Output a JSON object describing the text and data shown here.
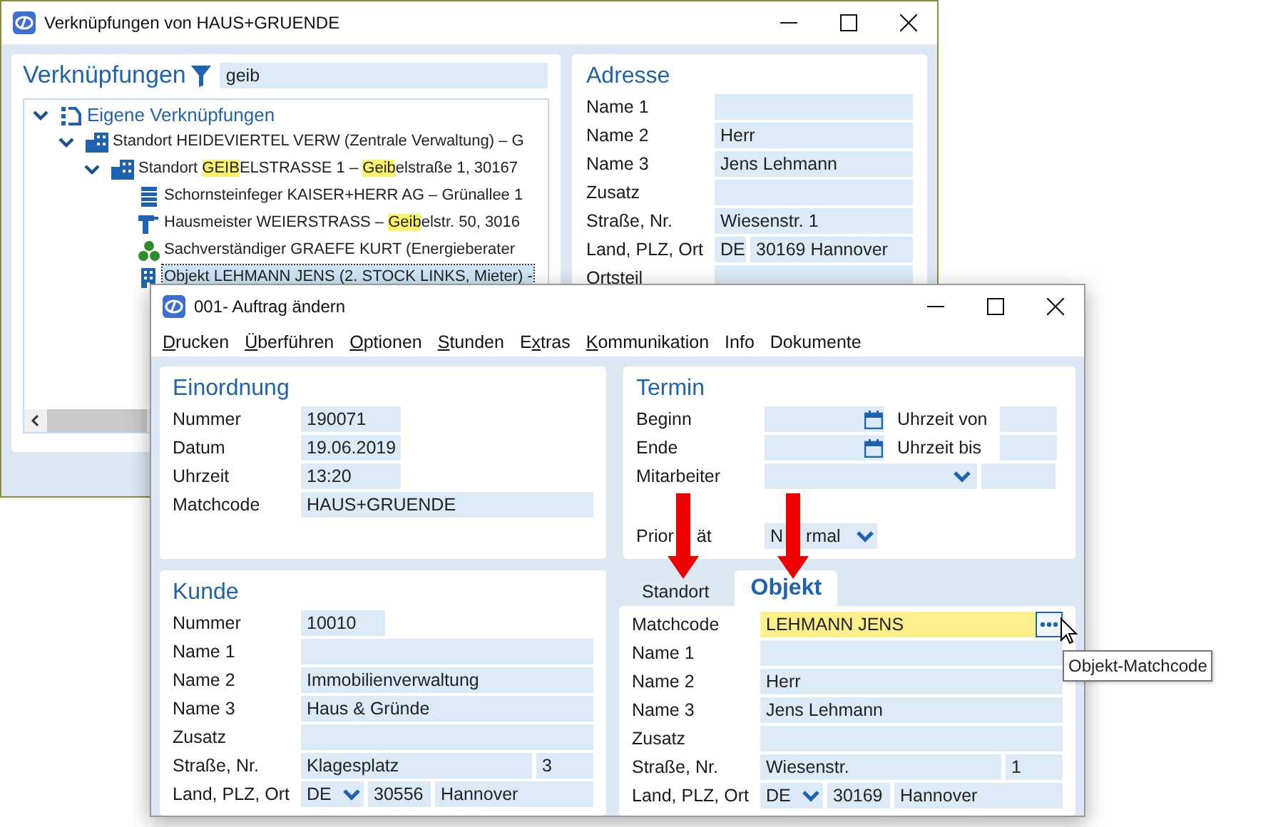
{
  "back_window": {
    "title": "Verknüpfungen von HAUS+GRUENDE",
    "tree_panel": {
      "title": "Verknüpfungen",
      "filter": {
        "value": "geib"
      },
      "tree": [
        {
          "kind": "group",
          "expanded": true,
          "selected": false,
          "segments": [
            {
              "text": "Eigene Verknüpfungen",
              "highlight": false
            }
          ],
          "children": [
            {
              "kind": "site",
              "expanded": true,
              "selected": false,
              "segments": [
                {
                  "text": "Standort HEIDEVIERTEL VERW (Zentrale Verwaltung) – G",
                  "highlight": false
                }
              ],
              "children": [
                {
                  "kind": "site",
                  "expanded": true,
                  "selected": false,
                  "segments": [
                    {
                      "text": "Standort ",
                      "highlight": false
                    },
                    {
                      "text": "GEIB",
                      "highlight": true
                    },
                    {
                      "text": "ELSTRASSE 1 – ",
                      "highlight": false
                    },
                    {
                      "text": "Geib",
                      "highlight": true
                    },
                    {
                      "text": "elstraße 1, 30167",
                      "highlight": false
                    }
                  ],
                  "children": [
                    {
                      "kind": "company",
                      "selected": false,
                      "segments": [
                        {
                          "text": "Schornsteinfeger KAISER+HERR AG – Grünallee 1",
                          "highlight": false
                        }
                      ]
                    },
                    {
                      "kind": "caretaker",
                      "selected": false,
                      "segments": [
                        {
                          "text": "Hausmeister WEIERSTRASS – ",
                          "highlight": false
                        },
                        {
                          "text": "Geib",
                          "highlight": true
                        },
                        {
                          "text": "elstr. 50, 3016",
                          "highlight": false
                        }
                      ]
                    },
                    {
                      "kind": "expert",
                      "selected": false,
                      "segments": [
                        {
                          "text": "Sachverständiger GRAEFE KURT (Energieberater",
                          "highlight": false
                        }
                      ]
                    },
                    {
                      "kind": "object",
                      "selected": true,
                      "segments": [
                        {
                          "text": "Objekt LEHMANN JENS (2. STOCK LINKS, Mieter) -",
                          "highlight": false
                        }
                      ]
                    }
                  ]
                }
              ]
            }
          ]
        }
      ]
    },
    "address_panel": {
      "title": "Adresse",
      "fields": [
        {
          "label": "Name 1",
          "cells": [
            {
              "kind": "full"
            }
          ]
        },
        {
          "label": "Name 2",
          "cells": [
            {
              "kind": "full",
              "text": "Herr"
            }
          ]
        },
        {
          "label": "Name 3",
          "cells": [
            {
              "kind": "full",
              "text": "Jens Lehmann"
            }
          ]
        },
        {
          "label": "Zusatz",
          "cells": [
            {
              "kind": "full"
            }
          ]
        },
        {
          "label": "Straße, Nr.",
          "cells": [
            {
              "kind": "full",
              "text": "Wiesenstr. 1"
            }
          ]
        },
        {
          "label": "Land, PLZ, Ort",
          "cells": [
            {
              "kind": "country_plain",
              "text": "DE"
            },
            {
              "kind": "full",
              "text": "30169 Hannover"
            }
          ]
        },
        {
          "label": "Ortsteil",
          "cells": [
            {
              "kind": "full"
            }
          ]
        }
      ]
    }
  },
  "front_window": {
    "title": "001- Auftrag ändern",
    "menu": [
      {
        "key": "D",
        "after": "rucken"
      },
      {
        "key": "Ü",
        "after": "berführen"
      },
      {
        "key": "O",
        "after": "ptionen"
      },
      {
        "key": "S",
        "after": "tunden"
      },
      {
        "before": "E",
        "key": "x",
        "after": "tras"
      },
      {
        "key": "K",
        "after": "ommunikation"
      },
      {
        "before": "Info"
      },
      {
        "before": "Dokumente"
      }
    ],
    "einordnung": {
      "title": "Einordnung",
      "fields": [
        {
          "label": "Nummer",
          "cells": [
            {
              "kind": "code",
              "text": "190071"
            }
          ]
        },
        {
          "label": "Datum",
          "cells": [
            {
              "kind": "code",
              "text": "19.06.2019"
            }
          ]
        },
        {
          "label": "Uhrzeit",
          "cells": [
            {
              "kind": "code",
              "text": "13:20"
            }
          ]
        },
        {
          "label": "Matchcode",
          "cells": [
            {
              "kind": "wide",
              "text": "HAUS+GRUENDE"
            }
          ]
        }
      ]
    },
    "termin": {
      "title": "Termin",
      "fields": [
        {
          "label": "Beginn",
          "cells": [
            {
              "kind": "date"
            },
            {
              "kind": "sublabel",
              "text": "Uhrzeit von"
            },
            {
              "kind": "time"
            }
          ]
        },
        {
          "label": "Ende",
          "cells": [
            {
              "kind": "date"
            },
            {
              "kind": "sublabel",
              "text": "Uhrzeit bis"
            },
            {
              "kind": "time"
            }
          ]
        },
        {
          "label": "Mitarbeiter",
          "cells": [
            {
              "kind": "select"
            },
            {
              "kind": "short_time"
            }
          ]
        },
        {
          "label_parts": [
            "Prior",
            "ät"
          ],
          "cells": [
            {
              "kind": "select_small",
              "parts": [
                "N",
                "rmal"
              ]
            }
          ],
          "spaced": true
        }
      ]
    },
    "kunde": {
      "title": "Kunde",
      "fields": [
        {
          "label": "Nummer",
          "cells": [
            {
              "kind": "id",
              "text": "10010"
            }
          ]
        },
        {
          "label": "Name 1",
          "cells": [
            {
              "kind": "full"
            }
          ]
        },
        {
          "label": "Name 2",
          "cells": [
            {
              "kind": "full",
              "text": "Immobilienverwaltung"
            }
          ]
        },
        {
          "label": "Name 3",
          "cells": [
            {
              "kind": "full",
              "text": "Haus & Gründe"
            }
          ]
        },
        {
          "label": "Zusatz",
          "cells": [
            {
              "kind": "full"
            }
          ]
        },
        {
          "label": "Straße, Nr.",
          "cells": [
            {
              "kind": "full",
              "text": "Klagesplatz"
            },
            {
              "kind": "house_no",
              "text": "3"
            }
          ]
        },
        {
          "label": "Land, PLZ, Ort",
          "cells": [
            {
              "kind": "country",
              "text": "DE"
            },
            {
              "kind": "zip",
              "text": "30556"
            },
            {
              "kind": "full",
              "text": "Hannover"
            }
          ]
        }
      ]
    },
    "tabs": [
      {
        "label": "Standort",
        "selected": false
      },
      {
        "label": "Objekt",
        "selected": true
      }
    ],
    "objekt": {
      "fields": [
        {
          "label": "Matchcode",
          "cells": [
            {
              "kind": "lookup",
              "text": "LEHMANN JENS"
            }
          ]
        },
        {
          "label": "Name 1",
          "cells": [
            {
              "kind": "full"
            }
          ]
        },
        {
          "label": "Name 2",
          "cells": [
            {
              "kind": "full",
              "text": "Herr"
            }
          ]
        },
        {
          "label": "Name 3",
          "cells": [
            {
              "kind": "full",
              "text": "Jens Lehmann"
            }
          ]
        },
        {
          "label": "Zusatz",
          "cells": [
            {
              "kind": "full"
            }
          ]
        },
        {
          "label": "Straße, Nr.",
          "cells": [
            {
              "kind": "full",
              "text": "Wiesenstr."
            },
            {
              "kind": "house_no",
              "text": "1"
            }
          ]
        },
        {
          "label": "Land, PLZ, Ort",
          "cells": [
            {
              "kind": "country",
              "text": "DE"
            },
            {
              "kind": "zip",
              "text": "30169"
            },
            {
              "kind": "full",
              "text": "Hannover"
            }
          ]
        }
      ]
    },
    "tooltip": "Objekt-Matchcode"
  }
}
